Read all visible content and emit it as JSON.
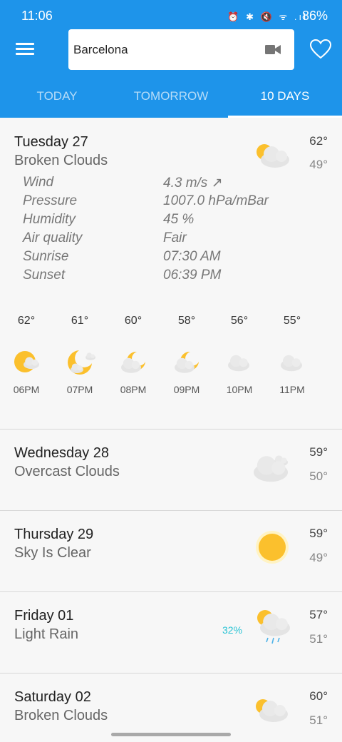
{
  "status": {
    "time": "11:06",
    "icons": "⏰ ✱ 🔇 ᯤ .ıl",
    "battery": "86%"
  },
  "search": {
    "value": "Barcelona"
  },
  "tabs": [
    {
      "label": "TODAY"
    },
    {
      "label": "TOMORROW"
    },
    {
      "label": "10 DAYS"
    }
  ],
  "active_tab": "10 DAYS",
  "days": [
    {
      "name": "Tuesday 27",
      "condition": "Broken Clouds",
      "high": "62°",
      "low": "49°",
      "icon": "broken-clouds-icon",
      "details": [
        {
          "label": "Wind",
          "value": "4.3 m/s ↗"
        },
        {
          "label": "Pressure",
          "value": "1007.0 hPa/mBar"
        },
        {
          "label": "Humidity",
          "value": "45 %"
        },
        {
          "label": "Air quality",
          "value": "Fair"
        },
        {
          "label": "Sunrise",
          "value": "07:30 AM"
        },
        {
          "label": "Sunset",
          "value": "06:39 PM"
        }
      ],
      "hourly": [
        {
          "temp": "62°",
          "time": "06PM",
          "icon": "sun-cloud-icon"
        },
        {
          "temp": "61°",
          "time": "07PM",
          "icon": "moon-cloud-icon"
        },
        {
          "temp": "60°",
          "time": "08PM",
          "icon": "moon-cloud-icon"
        },
        {
          "temp": "58°",
          "time": "09PM",
          "icon": "moon-cloud-icon"
        },
        {
          "temp": "56°",
          "time": "10PM",
          "icon": "cloud-icon"
        },
        {
          "temp": "55°",
          "time": "11PM",
          "icon": "cloud-icon"
        }
      ]
    },
    {
      "name": "Wednesday 28",
      "condition": "Overcast Clouds",
      "high": "59°",
      "low": "50°",
      "icon": "overcast-clouds-icon"
    },
    {
      "name": "Thursday 29",
      "condition": "Sky Is Clear",
      "high": "59°",
      "low": "49°",
      "icon": "sun-icon"
    },
    {
      "name": "Friday 01",
      "condition": "Light Rain",
      "high": "57°",
      "low": "51°",
      "icon": "light-rain-icon",
      "precipitation": "32%"
    },
    {
      "name": "Saturday 02",
      "condition": "Broken Clouds",
      "high": "60°",
      "low": "51°",
      "icon": "broken-clouds-icon"
    }
  ],
  "colors": {
    "primary": "#1e94ea",
    "sun": "#fbc02d",
    "cloud": "#e6e6e6",
    "precip": "#28c3d4"
  }
}
